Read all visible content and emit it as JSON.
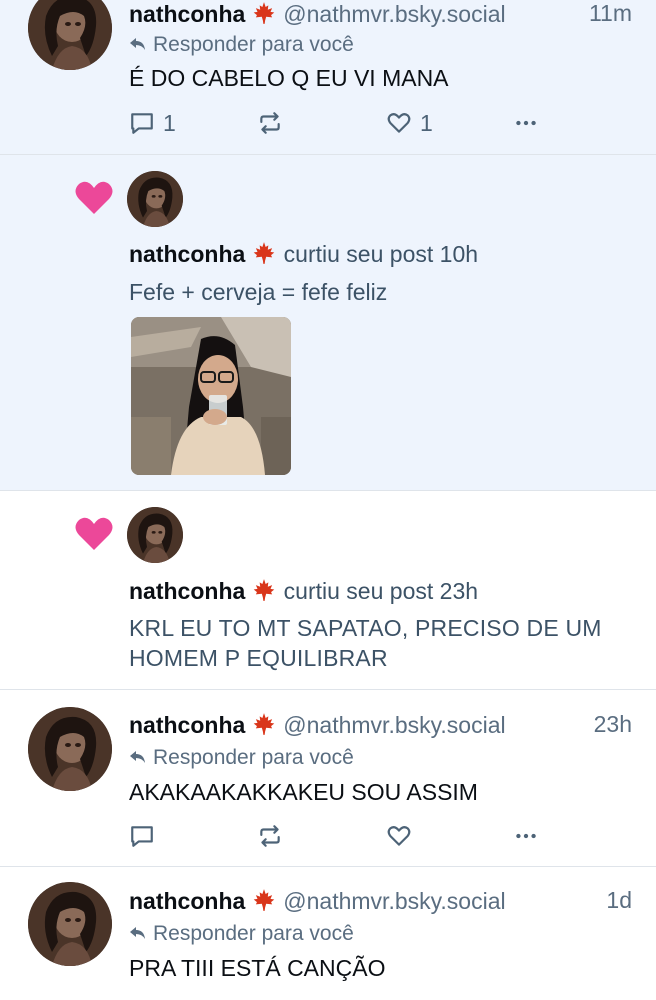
{
  "colors": {
    "unread_bg": "#eef4fd",
    "heart": "#ec4899",
    "muted": "#5a6d80",
    "leaf": "#d9361b"
  },
  "icons": {
    "leaf": "maple-leaf-icon",
    "heart": "heart-icon",
    "reply": "reply-arrow-icon",
    "comment": "comment-icon",
    "repost": "repost-icon",
    "like": "like-heart-icon",
    "more": "more-dots-icon"
  },
  "notifications": [
    {
      "name": "nathconha",
      "handle": "@nathmvr.bsky.social",
      "time": "11m",
      "reply_label": "Responder para você",
      "text": "É DO CABELO Q EU VI MANA",
      "reply_count": "1",
      "like_count": "1"
    },
    {
      "name": "nathconha",
      "action": "curtiu seu post",
      "time": "10h",
      "post_text": "Fefe + cerveja = fefe feliz"
    },
    {
      "name": "nathconha",
      "action": "curtiu seu post",
      "time": "23h",
      "post_text": "KRL EU TO MT SAPATAO, PRECISO DE UM HOMEM P EQUILIBRAR"
    },
    {
      "name": "nathconha",
      "handle": "@nathmvr.bsky.social",
      "time": "23h",
      "reply_label": "Responder para você",
      "text": "AKAKAAKAKKAKEU SOU ASSIM",
      "reply_count": "",
      "like_count": ""
    },
    {
      "name": "nathconha",
      "handle": "@nathmvr.bsky.social",
      "time": "1d",
      "reply_label": "Responder para você",
      "text": "PRA TIII ESTÁ CANÇÃO"
    }
  ]
}
